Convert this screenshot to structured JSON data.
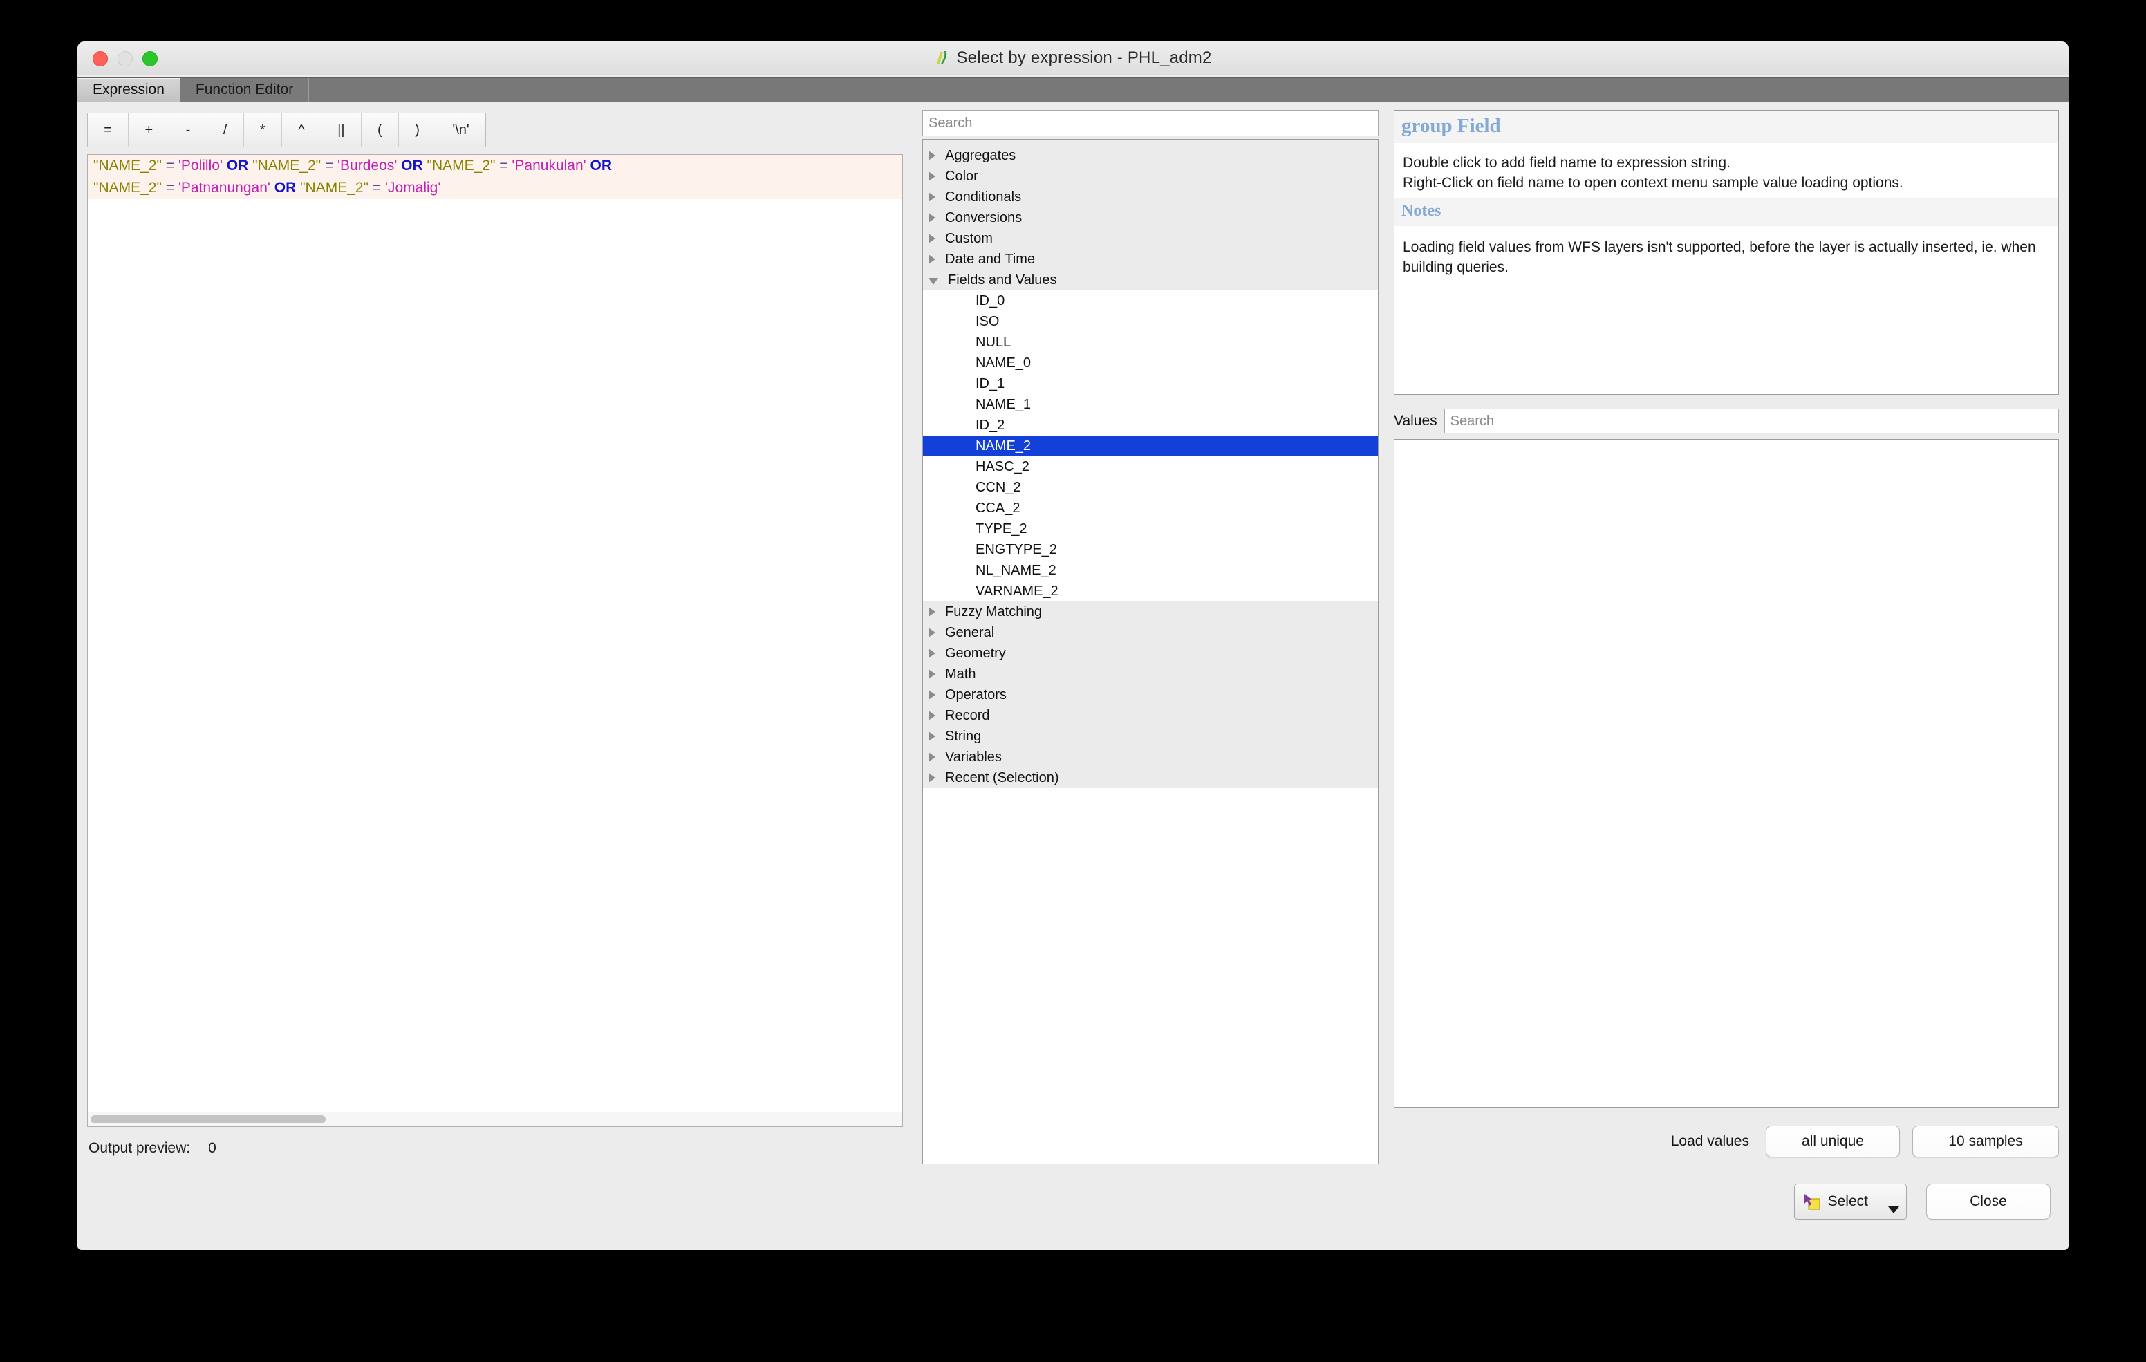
{
  "window": {
    "title": "Select by expression - PHL_adm2",
    "app_icon": "qgis-icon",
    "traffic_lights": [
      "close",
      "minimize",
      "zoom"
    ]
  },
  "tabs": [
    {
      "label": "Expression",
      "active": true
    },
    {
      "label": "Function Editor",
      "active": false
    }
  ],
  "operators": [
    {
      "label": "=",
      "name": "equals"
    },
    {
      "label": "+",
      "name": "plus"
    },
    {
      "label": "-",
      "name": "minus"
    },
    {
      "label": "/",
      "name": "divide"
    },
    {
      "label": "*",
      "name": "multiply"
    },
    {
      "label": "^",
      "name": "power"
    },
    {
      "label": "||",
      "name": "concat"
    },
    {
      "label": "(",
      "name": "open-paren"
    },
    {
      "label": ")",
      "name": "close-paren"
    },
    {
      "label": "'\\n'",
      "name": "newline"
    }
  ],
  "expression": {
    "line1": [
      {
        "t": "field",
        "v": "\"NAME_2\""
      },
      {
        "t": "eq",
        "v": "="
      },
      {
        "t": "str",
        "v": "'Polillo'"
      },
      {
        "t": "or",
        "v": "OR"
      },
      {
        "t": "field",
        "v": "\"NAME_2\""
      },
      {
        "t": "eq",
        "v": "="
      },
      {
        "t": "str",
        "v": "'Burdeos'"
      },
      {
        "t": "or",
        "v": "OR"
      },
      {
        "t": "field",
        "v": "\"NAME_2\""
      },
      {
        "t": "eq",
        "v": "="
      },
      {
        "t": "str",
        "v": "'Panukulan'"
      },
      {
        "t": "or",
        "v": "OR"
      }
    ],
    "line2": [
      {
        "t": "field",
        "v": "\"NAME_2\""
      },
      {
        "t": "eq",
        "v": "="
      },
      {
        "t": "str",
        "v": "'Patnanungan'"
      },
      {
        "t": "or",
        "v": "OR"
      },
      {
        "t": "field",
        "v": "\"NAME_2\""
      },
      {
        "t": "eq",
        "v": "="
      },
      {
        "t": "str",
        "v": "'Jomalig'"
      }
    ],
    "raw": "\"NAME_2\" = 'Polillo' OR \"NAME_2\" = 'Burdeos' OR \"NAME_2\" = 'Panukulan' OR \"NAME_2\" = 'Patnanungan' OR \"NAME_2\" = 'Jomalig'"
  },
  "output_preview": {
    "label": "Output preview:",
    "value": "0"
  },
  "function_tree": {
    "search_placeholder": "Search",
    "nodes": [
      {
        "label": "Aggregates",
        "type": "group",
        "expanded": false
      },
      {
        "label": "Color",
        "type": "group",
        "expanded": false
      },
      {
        "label": "Conditionals",
        "type": "group",
        "expanded": false
      },
      {
        "label": "Conversions",
        "type": "group",
        "expanded": false
      },
      {
        "label": "Custom",
        "type": "group",
        "expanded": false
      },
      {
        "label": "Date and Time",
        "type": "group",
        "expanded": false
      },
      {
        "label": "Fields and Values",
        "type": "group",
        "expanded": true
      },
      {
        "label": "ID_0",
        "type": "leaf",
        "selected": false
      },
      {
        "label": "ISO",
        "type": "leaf",
        "selected": false
      },
      {
        "label": "NULL",
        "type": "leaf",
        "selected": false
      },
      {
        "label": "NAME_0",
        "type": "leaf",
        "selected": false
      },
      {
        "label": "ID_1",
        "type": "leaf",
        "selected": false
      },
      {
        "label": "NAME_1",
        "type": "leaf",
        "selected": false
      },
      {
        "label": "ID_2",
        "type": "leaf",
        "selected": false
      },
      {
        "label": "NAME_2",
        "type": "leaf",
        "selected": true
      },
      {
        "label": "HASC_2",
        "type": "leaf",
        "selected": false
      },
      {
        "label": "CCN_2",
        "type": "leaf",
        "selected": false
      },
      {
        "label": "CCA_2",
        "type": "leaf",
        "selected": false
      },
      {
        "label": "TYPE_2",
        "type": "leaf",
        "selected": false
      },
      {
        "label": "ENGTYPE_2",
        "type": "leaf",
        "selected": false
      },
      {
        "label": "NL_NAME_2",
        "type": "leaf",
        "selected": false
      },
      {
        "label": "VARNAME_2",
        "type": "leaf",
        "selected": false
      },
      {
        "label": "Fuzzy Matching",
        "type": "group",
        "expanded": false
      },
      {
        "label": "General",
        "type": "group",
        "expanded": false
      },
      {
        "label": "Geometry",
        "type": "group",
        "expanded": false
      },
      {
        "label": "Math",
        "type": "group",
        "expanded": false
      },
      {
        "label": "Operators",
        "type": "group",
        "expanded": false
      },
      {
        "label": "Record",
        "type": "group",
        "expanded": false
      },
      {
        "label": "String",
        "type": "group",
        "expanded": false
      },
      {
        "label": "Variables",
        "type": "group",
        "expanded": false
      },
      {
        "label": "Recent (Selection)",
        "type": "group",
        "expanded": false
      }
    ]
  },
  "help": {
    "title": "group Field",
    "body_line1": "Double click to add field name to expression string.",
    "body_line2": "Right-Click on field name to open context menu sample value loading options.",
    "notes_title": "Notes",
    "notes_body": "Loading field values from WFS layers isn't supported, before the layer is actually inserted, ie. when building queries."
  },
  "values_panel": {
    "label": "Values",
    "search_placeholder": "Search",
    "items": [],
    "load_label": "Load values",
    "all_unique_label": "all unique",
    "samples_label": "10 samples"
  },
  "footer": {
    "select_label": "Select",
    "select_icon": "select-features-icon",
    "close_label": "Close"
  },
  "colors": {
    "selection_blue": "#1240d8",
    "help_heading": "#84a9d6",
    "field_token": "#8a8000",
    "string_token": "#c21fb3",
    "or_token": "#1414c8",
    "eq_token": "#6b3f9e",
    "window_chrome": "#ececec",
    "tab_strip": "#787878"
  }
}
